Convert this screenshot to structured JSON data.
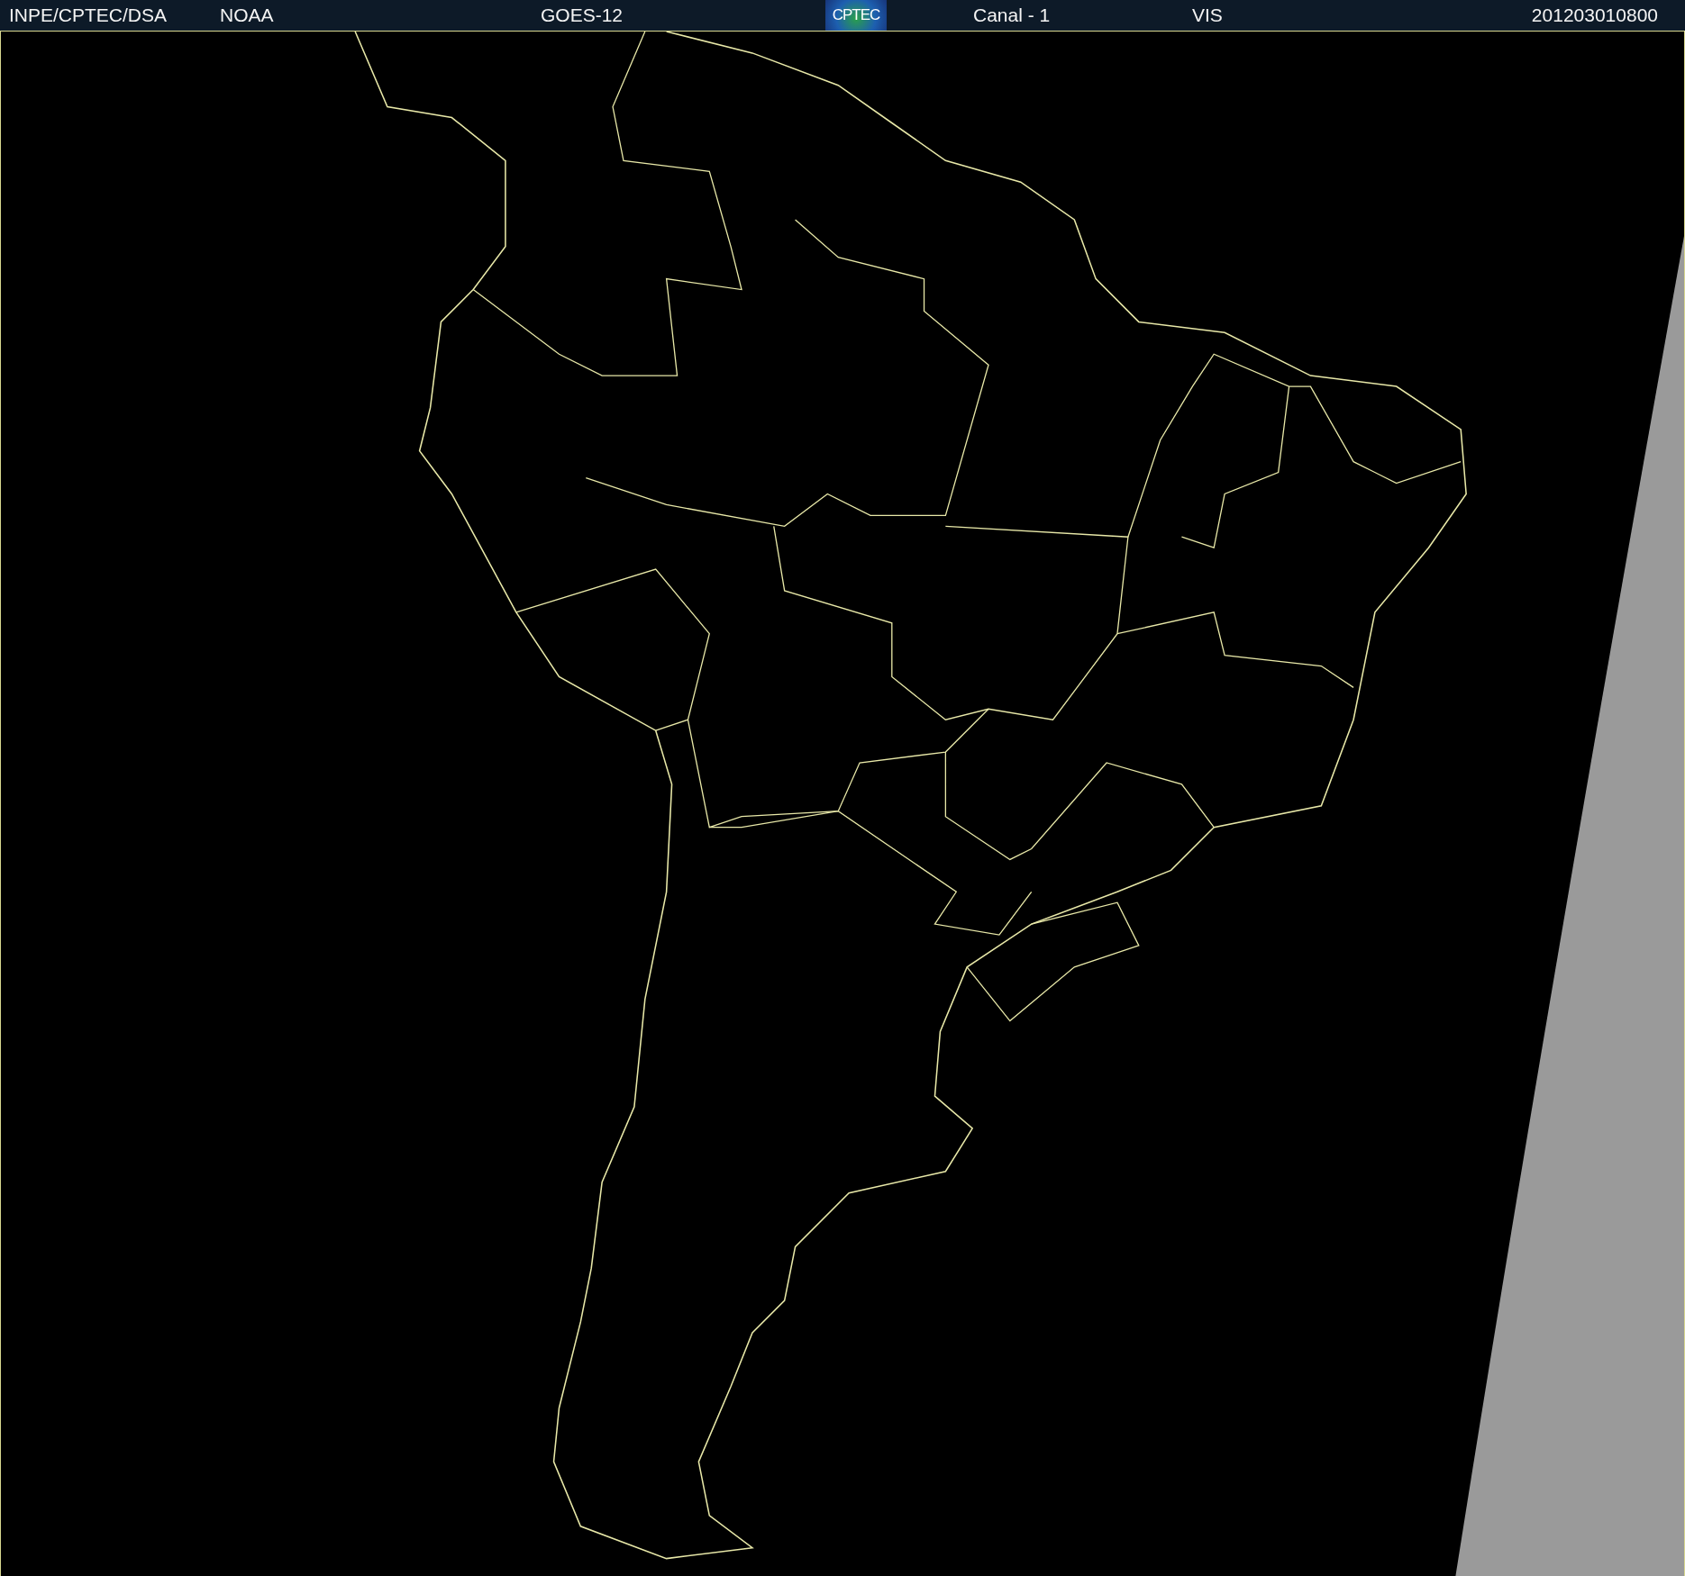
{
  "header": {
    "labels": [
      "INPE/CPTEC/DSA",
      "NOAA",
      "GOES-12",
      "Canal - 1",
      "VIS",
      "201203010800"
    ],
    "logo": "CPTEC"
  }
}
